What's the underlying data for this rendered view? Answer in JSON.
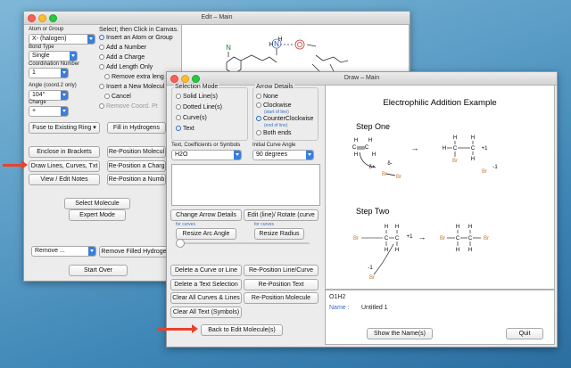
{
  "edit_window": {
    "title": "Edit – Main",
    "atom_group_label": "Atom or Group",
    "atom_group_value": "X- (halogen)",
    "bond_type_label": "Bond Type",
    "bond_type_value": "Single",
    "coord_label": "Coordination Number",
    "coord_value": "1",
    "angle_label": "Angle (coord.2 only)",
    "angle_value": "104°",
    "charge_label": "Charge",
    "charge_value": "+",
    "select_label": "Select; then Click in Canvas.",
    "options": [
      "Insert an Atom or Group",
      "Add a Number",
      "Add a Charge",
      "Add Length Only",
      "Remove extra leng",
      "Insert a New Molecul",
      "Cancel",
      "Remove Coord. Pt"
    ],
    "fuse_ring": "Fuse to Existing Ring",
    "fill_hydrogens": "Fill in Hydrogens",
    "enclose_brackets": "Enclose in Brackets",
    "reposition_molecule": "Re-Position Molecul",
    "draw_lines": "Draw Lines, Curves, Txt",
    "reposition_charge": "Re-Position a Charg",
    "view_edit_notes": "View / Edit Notes",
    "reposition_number": "Re-Position a Numb",
    "select_molecule": "Select Molecule",
    "expert_mode": "Expert Mode",
    "remove_select": "Remove ...",
    "remove_filled_hydrogens": "Remove Filled Hydroge",
    "start_over": "Start Over",
    "canvas_atoms": {
      "n1": "N",
      "h1": "H",
      "n2": "N",
      "h2": "H",
      "o": "O"
    }
  },
  "draw_window": {
    "title": "Draw – Main",
    "selection_mode_label": "Selection Mode",
    "selection_modes": [
      "Solid Line(s)",
      "Dotted Line(s)",
      "Curve(s)",
      "Text"
    ],
    "arrow_details_label": "Arrow Details",
    "arrow_none": "None",
    "arrow_cw": "Clockwise",
    "arrow_cw_hint": "(start of line)",
    "arrow_ccw": "CounterClockwise",
    "arrow_ccw_hint": "(end of line)",
    "arrow_both": "Both ends",
    "text_label": "Text, Coefficients or Symbols",
    "text_value": "H2O",
    "curve_angle_label": "Initial Curve Angle",
    "curve_angle_value": "90 degrees",
    "change_arrow_details": "Change Arrow Details",
    "edit_rotate_curve": "Edit (line)/ Rotate (curve",
    "for_curves_1": "for curves",
    "for_curves_2": "for curves",
    "resize_arc_angle": "Resize Arc Angle",
    "resize_radius": "Resize Radius",
    "delete_curve_line": "Delete a Curve or Line",
    "reposition_line_curve": "Re-Position Line/Curve",
    "delete_text_selection": "Delete a Text Selection",
    "reposition_text": "Re-Position Text",
    "clear_all_curves": "Clear All Curves & Lines",
    "reposition_molecule": "Re-Position Molecule",
    "clear_all_text": "Clear All Text (Symbols)",
    "back_to_edit": "Back to Edit Molecule(s)",
    "formula": "O1H2",
    "name_label": "Name :",
    "name_value": "Untitled 1",
    "show_names": "Show the Name(s)",
    "quit": "Quit"
  },
  "diagram": {
    "title": "Electrophilic Addition Example",
    "step_one": "Step One",
    "step_two": "Step Two",
    "h": "H",
    "c": "C",
    "br": "Br",
    "delta_plus": "δ+",
    "delta_minus": "δ-",
    "plus_one": "+1",
    "minus_one": "-1",
    "arrow": "→"
  },
  "colors": {
    "accent": "#3a7ed8",
    "red_arrow": "#e8422f",
    "bromine": "#c8782a"
  }
}
